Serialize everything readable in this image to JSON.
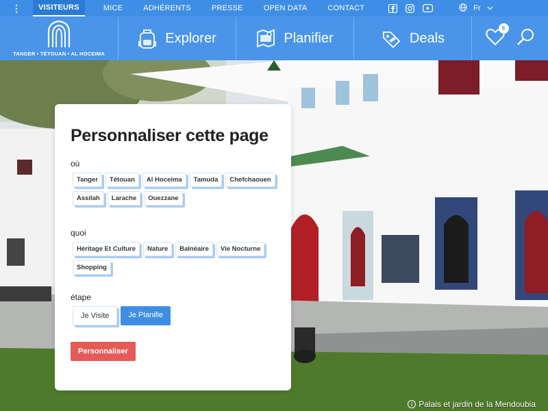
{
  "topbar": {
    "menu_icon": "more-vertical-icon",
    "items": [
      "VISITEURS",
      "MICE",
      "ADHÉRENTS",
      "PRESSE",
      "OPEN DATA",
      "CONTACT"
    ],
    "language": "Fr"
  },
  "mainnav": {
    "logo_text": "TANGER • TÉTOUAN • AL HOCEIMA",
    "explore": "Explorer",
    "plan": "Planifier",
    "deals": "Deals",
    "favorites_count": "6"
  },
  "card": {
    "title": "Personnaliser cette page",
    "where_label": "où",
    "where_tags": [
      "Tanger",
      "Tétouan",
      "Al Hoceima",
      "Tamuda",
      "Chefchaouen",
      "Assilah",
      "Larache",
      "Ouezzane"
    ],
    "what_label": "quoi",
    "what_tags": [
      "Héritage Et Culture",
      "Nature",
      "Balnéaire",
      "Vie Nocturne",
      "Shopping"
    ],
    "stage_label": "étape",
    "stage_visit": "Je Visite",
    "stage_plan": "Je Planifie",
    "submit": "Personnaliser"
  },
  "credit": "Palais et jardin de la Mendoubia",
  "colors": {
    "primary": "#3f8ee6",
    "nav": "#4a95ea",
    "cta": "#e65a57",
    "tag_shadow": "#a9cdf4"
  }
}
